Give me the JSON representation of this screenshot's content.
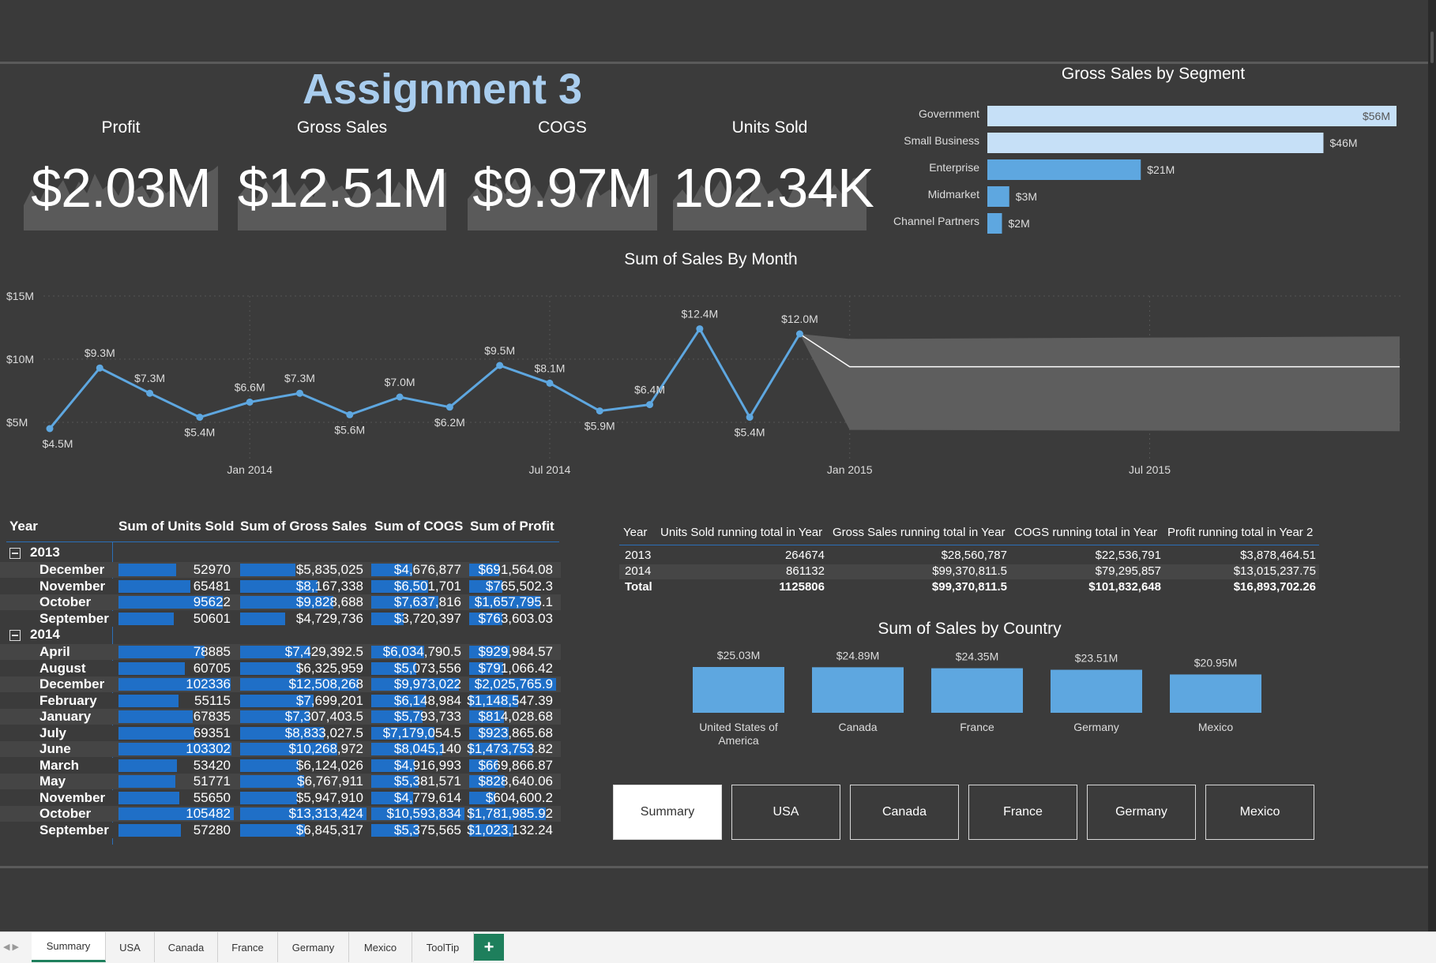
{
  "report": {
    "title": "Assignment 3"
  },
  "kpis": [
    {
      "label": "Profit",
      "value": "$2.03M"
    },
    {
      "label": "Gross Sales",
      "value": "$12.51M"
    },
    {
      "label": "COGS",
      "value": "$9.97M"
    },
    {
      "label": "Units Sold",
      "value": "102.34K"
    }
  ],
  "colors": {
    "background": "#3b3b3b",
    "title": "#a9cdee",
    "bar_light": "#c6e0f7",
    "bar_mid": "#5ea7e0",
    "data_bar": "#1f6fc7",
    "active_tab": "#1e7f5c"
  },
  "chart_data": [
    {
      "id": "segment",
      "type": "bar",
      "orientation": "horizontal",
      "title": "Gross Sales by Segment",
      "categories": [
        "Government",
        "Small Business",
        "Enterprise",
        "Midmarket",
        "Channel Partners"
      ],
      "values": [
        56,
        46,
        21,
        3,
        2
      ],
      "labels": [
        "$56M",
        "$46M",
        "$21M",
        "$3M",
        "$2M"
      ],
      "unit": "M"
    },
    {
      "id": "monthly",
      "type": "line",
      "title": "Sum of Sales By Month",
      "x": [
        "2013-09",
        "2013-10",
        "2013-11",
        "2013-12",
        "2014-01",
        "2014-02",
        "2014-03",
        "2014-04",
        "2014-05",
        "2014-06",
        "2014-07",
        "2014-08",
        "2014-09",
        "2014-10",
        "2014-11",
        "2014-12"
      ],
      "values": [
        4.5,
        9.3,
        7.3,
        5.4,
        6.6,
        7.3,
        5.6,
        7.0,
        6.2,
        9.5,
        8.1,
        5.9,
        6.4,
        12.4,
        5.4,
        12.0
      ],
      "labels": [
        "$4.5M",
        "$9.3M",
        "$7.3M",
        "$5.4M",
        "$6.6M",
        "$7.3M",
        "$5.6M",
        "$7.0M",
        "$6.2M",
        "$9.5M",
        "$8.1M",
        "$5.9M",
        "$6.4M",
        "$12.4M",
        "$5.4M",
        "$12.0M"
      ],
      "y_ticks": [
        "$15M",
        "$10M",
        "$5M"
      ],
      "y_tick_values": [
        15,
        10,
        5
      ],
      "x_ticks": [
        "Jan 2014",
        "Jul 2014",
        "Jan 2015",
        "Jul 2015"
      ],
      "x_tick_dates": [
        "2014-01",
        "2014-07",
        "2015-01",
        "2015-07"
      ],
      "x_end": "2015-12",
      "forecast": {
        "start": "2014-12",
        "end": "2015-12",
        "mean": 9.4,
        "upper": 11.8,
        "lower": 4.3
      },
      "grid": true
    },
    {
      "id": "country",
      "type": "bar",
      "title": "Sum of Sales by Country",
      "categories": [
        "United States of America",
        "Canada",
        "France",
        "Germany",
        "Mexico"
      ],
      "values": [
        25.03,
        24.89,
        24.35,
        23.51,
        20.95
      ],
      "labels": [
        "$25.03M",
        "$24.89M",
        "$24.35M",
        "$23.51M",
        "$20.95M"
      ]
    }
  ],
  "matrix": {
    "headers": [
      "Year",
      "Sum of Units Sold",
      "Sum of Gross Sales",
      "Sum of COGS",
      "Sum of Profit"
    ],
    "groups": [
      {
        "year": "2013",
        "rows": [
          {
            "month": "December",
            "units": "52970",
            "gross": "$5,835,025",
            "cogs": "$4,676,877",
            "profit": "$691,564.08",
            "u": 52970,
            "g": 5835025,
            "c": 4676877,
            "p": 691564
          },
          {
            "month": "November",
            "units": "65481",
            "gross": "$8,167,338",
            "cogs": "$6,501,701",
            "profit": "$765,502.3",
            "u": 65481,
            "g": 8167338,
            "c": 6501701,
            "p": 765502
          },
          {
            "month": "October",
            "units": "95622",
            "gross": "$9,828,688",
            "cogs": "$7,637,816",
            "profit": "$1,657,795.1",
            "u": 95622,
            "g": 9828688,
            "c": 7637816,
            "p": 1657795
          },
          {
            "month": "September",
            "units": "50601",
            "gross": "$4,729,736",
            "cogs": "$3,720,397",
            "profit": "$763,603.03",
            "u": 50601,
            "g": 4729736,
            "c": 3720397,
            "p": 763603
          }
        ]
      },
      {
        "year": "2014",
        "rows": [
          {
            "month": "April",
            "units": "78885",
            "gross": "$7,429,392.5",
            "cogs": "$6,034,790.5",
            "profit": "$929,984.57",
            "u": 78885,
            "g": 7429392,
            "c": 6034790,
            "p": 929984
          },
          {
            "month": "August",
            "units": "60705",
            "gross": "$6,325,959",
            "cogs": "$5,073,556",
            "profit": "$791,066.42",
            "u": 60705,
            "g": 6325959,
            "c": 5073556,
            "p": 791066
          },
          {
            "month": "December",
            "units": "102336",
            "gross": "$12,508,268",
            "cogs": "$9,973,022",
            "profit": "$2,025,765.9",
            "u": 102336,
            "g": 12508268,
            "c": 9973022,
            "p": 2025765
          },
          {
            "month": "February",
            "units": "55115",
            "gross": "$7,699,201",
            "cogs": "$6,148,984",
            "profit": "$1,148,547.39",
            "u": 55115,
            "g": 7699201,
            "c": 6148984,
            "p": 1148547
          },
          {
            "month": "January",
            "units": "67835",
            "gross": "$7,307,403.5",
            "cogs": "$5,793,733",
            "profit": "$814,028.68",
            "u": 67835,
            "g": 7307403,
            "c": 5793733,
            "p": 814028
          },
          {
            "month": "July",
            "units": "69351",
            "gross": "$8,833,027.5",
            "cogs": "$7,179,054.5",
            "profit": "$923,865.68",
            "u": 69351,
            "g": 8833027,
            "c": 7179054,
            "p": 923865
          },
          {
            "month": "June",
            "units": "103302",
            "gross": "$10,268,972",
            "cogs": "$8,045,140",
            "profit": "$1,473,753.82",
            "u": 103302,
            "g": 10268972,
            "c": 8045140,
            "p": 1473753
          },
          {
            "month": "March",
            "units": "53420",
            "gross": "$6,124,026",
            "cogs": "$4,916,993",
            "profit": "$669,866.87",
            "u": 53420,
            "g": 6124026,
            "c": 4916993,
            "p": 669866
          },
          {
            "month": "May",
            "units": "51771",
            "gross": "$6,767,911",
            "cogs": "$5,381,571",
            "profit": "$828,640.06",
            "u": 51771,
            "g": 6767911,
            "c": 5381571,
            "p": 828640
          },
          {
            "month": "November",
            "units": "55650",
            "gross": "$5,947,910",
            "cogs": "$4,779,614",
            "profit": "$604,600.2",
            "u": 55650,
            "g": 5947910,
            "c": 4779614,
            "p": 604600
          },
          {
            "month": "October",
            "units": "105482",
            "gross": "$13,313,424",
            "cogs": "$10,593,834",
            "profit": "$1,781,985.92",
            "u": 105482,
            "g": 13313424,
            "c": 10593834,
            "p": 1781985
          },
          {
            "month": "September",
            "units": "57280",
            "gross": "$6,845,317",
            "cogs": "$5,375,565",
            "profit": "$1,023,132.24",
            "u": 57280,
            "g": 6845317,
            "c": 5375565,
            "p": 1023132
          }
        ]
      }
    ]
  },
  "running_table": {
    "headers": [
      "Year",
      "Units Sold running total in Year",
      "Gross Sales running total in Year",
      "COGS running total in Year",
      "Profit running total in Year 2"
    ],
    "rows": [
      [
        "2013",
        "264674",
        "$28,560,787",
        "$22,536,791",
        "$3,878,464.51"
      ],
      [
        "2014",
        "861132",
        "$99,370,811.5",
        "$79,295,857",
        "$13,015,237.75"
      ]
    ],
    "total": [
      "Total",
      "1125806",
      "$99,370,811.5",
      "$101,832,648",
      "$16,893,702.26"
    ]
  },
  "nav_buttons": [
    {
      "label": "Summary",
      "active": true
    },
    {
      "label": "USA",
      "active": false
    },
    {
      "label": "Canada",
      "active": false
    },
    {
      "label": "France",
      "active": false
    },
    {
      "label": "Germany",
      "active": false
    },
    {
      "label": "Mexico",
      "active": false
    }
  ],
  "page_tabs": [
    {
      "label": "Summary",
      "active": true
    },
    {
      "label": "USA",
      "active": false
    },
    {
      "label": "Canada",
      "active": false
    },
    {
      "label": "France",
      "active": false
    },
    {
      "label": "Germany",
      "active": false
    },
    {
      "label": "Mexico",
      "active": false
    },
    {
      "label": "ToolTip",
      "active": false
    }
  ],
  "add_tab_label": "+"
}
